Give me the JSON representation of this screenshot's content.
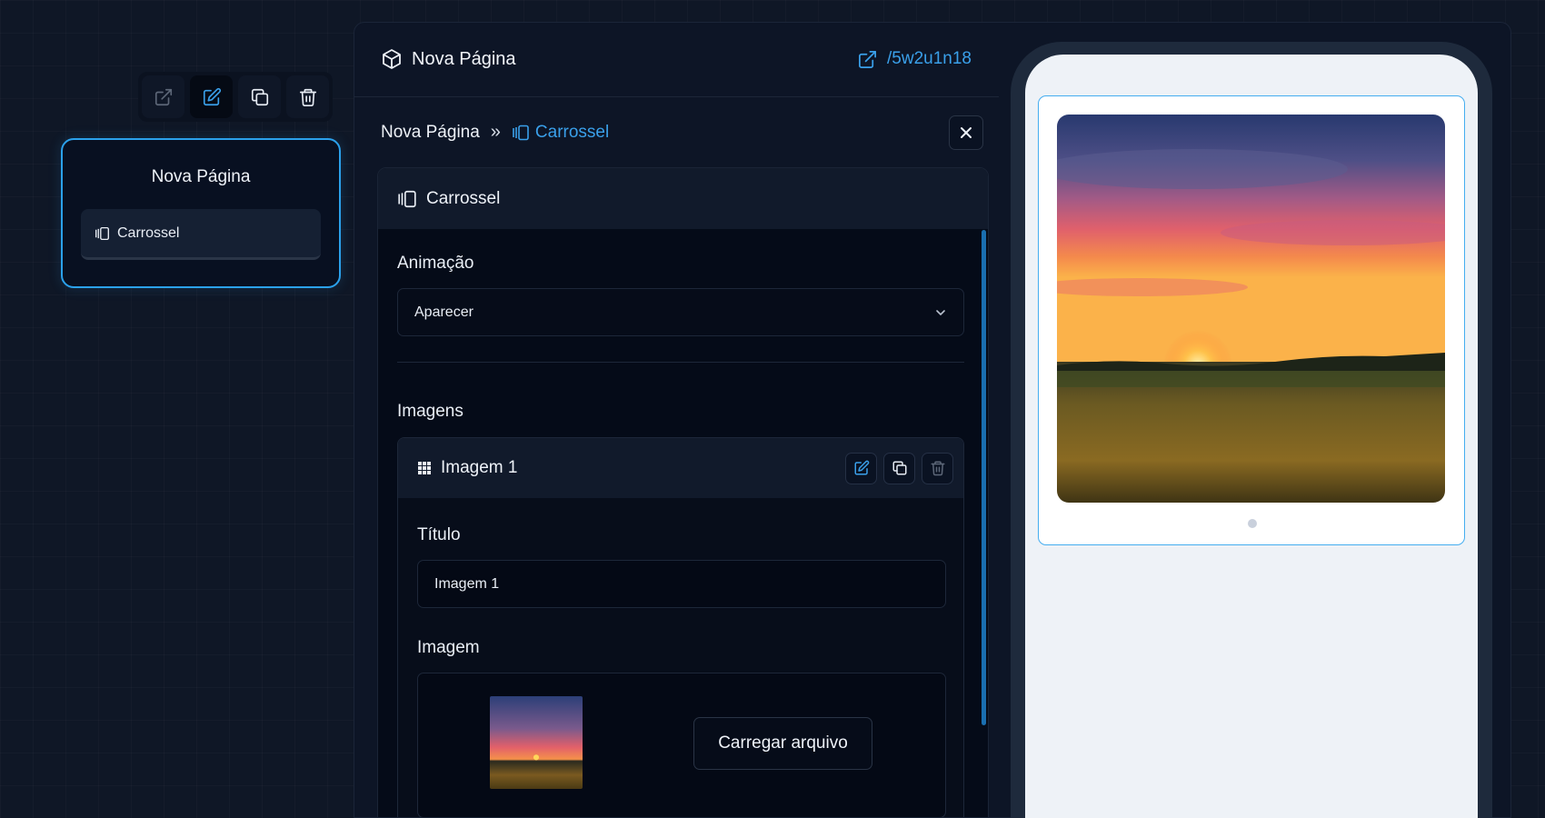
{
  "toolbar": {
    "buttons": [
      {
        "icon": "external-link-icon",
        "state": "default"
      },
      {
        "icon": "edit-icon",
        "state": "active"
      },
      {
        "icon": "copy-icon",
        "state": "default"
      },
      {
        "icon": "trash-icon",
        "state": "default"
      }
    ]
  },
  "node_card": {
    "title": "Nova Página",
    "item_label": "Carrossel",
    "item_icon": "carousel-icon"
  },
  "editor": {
    "page_title": "Nova Página",
    "page_icon": "cube-icon",
    "page_slug": "/5w2u1n18",
    "breadcrumb": {
      "root": "Nova Página",
      "separator": "»",
      "current": "Carrossel"
    },
    "component_title": "Carrossel",
    "animation_label": "Animação",
    "animation_value": "Aparecer",
    "images_label": "Imagens",
    "image_item": {
      "name": "Imagem 1",
      "title_label": "Título",
      "title_value": "Imagem 1",
      "image_label": "Imagem",
      "upload_button": "Carregar arquivo"
    }
  },
  "preview": {
    "slide_count": 1,
    "active_slide": 1
  },
  "colors": {
    "accent": "#2ba1ec",
    "background": "#0f1726",
    "panel": "#0d1526",
    "preview_screen": "#eef2f7"
  }
}
